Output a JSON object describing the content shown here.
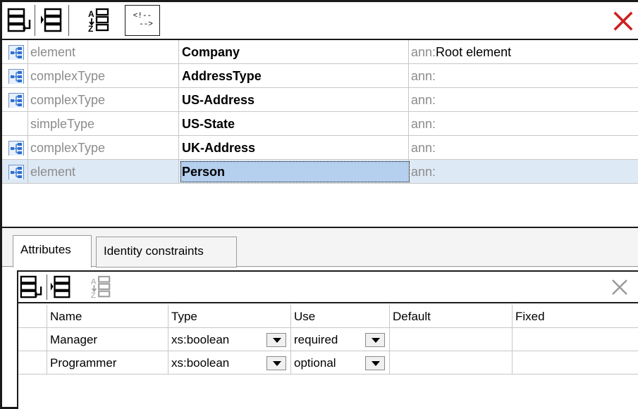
{
  "components": [
    {
      "kind": "element",
      "name": "Company",
      "ann_prefix": "ann:",
      "ann_text": "Root element",
      "has_icon": true,
      "selected": false
    },
    {
      "kind": "complexType",
      "name": "AddressType",
      "ann_prefix": "ann:",
      "ann_text": "",
      "has_icon": true,
      "selected": false
    },
    {
      "kind": "complexType",
      "name": "US-Address",
      "ann_prefix": "ann:",
      "ann_text": "",
      "has_icon": true,
      "selected": false
    },
    {
      "kind": "simpleType",
      "name": "US-State",
      "ann_prefix": "ann:",
      "ann_text": "",
      "has_icon": false,
      "selected": false
    },
    {
      "kind": "complexType",
      "name": "UK-Address",
      "ann_prefix": "ann:",
      "ann_text": "",
      "has_icon": true,
      "selected": false
    },
    {
      "kind": "element",
      "name": "Person",
      "ann_prefix": "ann:",
      "ann_text": "",
      "has_icon": true,
      "selected": true
    }
  ],
  "tabs": [
    {
      "label": "Attributes",
      "active": true
    },
    {
      "label": "Identity constraints",
      "active": false
    }
  ],
  "attributes_grid": {
    "headers": [
      "Name",
      "Type",
      "Use",
      "Default",
      "Fixed"
    ],
    "rows": [
      {
        "name": "Manager",
        "type": "xs:boolean",
        "use": "required",
        "default": "",
        "fixed": ""
      },
      {
        "name": "Programmer",
        "type": "xs:boolean",
        "use": "optional",
        "default": "",
        "fixed": ""
      }
    ]
  },
  "toolbar": {
    "comment_icon_text_top": "<!--",
    "comment_icon_text_bottom": "-->"
  },
  "colors": {
    "close_red": "#cc1f1f",
    "selection": "#dde9f5",
    "muted_text": "#8c8c8c",
    "icon_blue": "#2f6fd1"
  }
}
